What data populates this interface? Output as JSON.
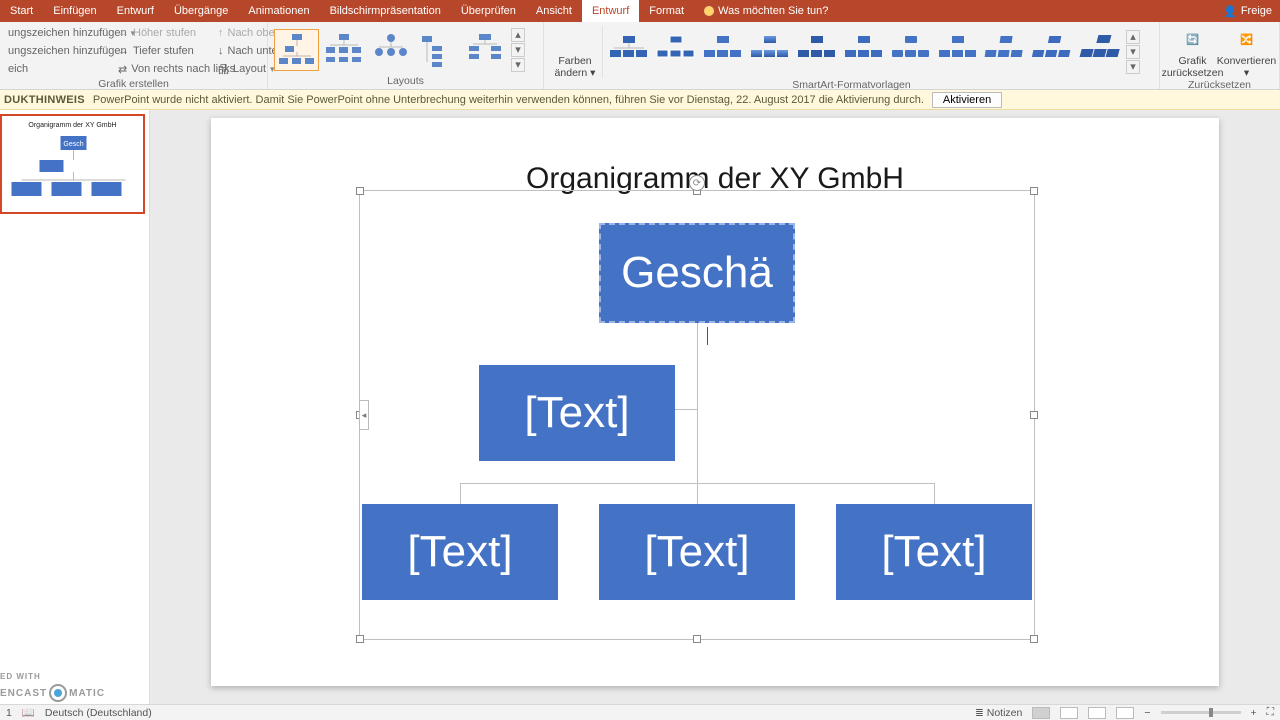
{
  "tabs": [
    "Start",
    "Einfügen",
    "Entwurf",
    "Übergänge",
    "Animationen",
    "Bildschirmpräsentation",
    "Überprüfen",
    "Ansicht",
    "Entwurf",
    "Format"
  ],
  "active_tab_index": 8,
  "tell_me": "Was möchten Sie tun?",
  "user": "Freige",
  "ribbon": {
    "create": {
      "add_bullet": "ungszeichen hinzufügen",
      "add_bullet2": "ungszeichen hinzufügen",
      "eich": "eich",
      "promote": "Höher stufen",
      "demote": "Tiefer stufen",
      "rtl": "Von rechts nach links",
      "up": "Nach oben",
      "down": "Nach unten",
      "layout_btn": "Layout",
      "label": "Grafik erstellen"
    },
    "layouts_label": "Layouts",
    "colors": {
      "label1": "Farben",
      "label2": "ändern"
    },
    "styles_label": "SmartArt-Formatvorlagen",
    "reset": {
      "graphic1": "Grafik",
      "graphic2": "zurücksetzen",
      "convert": "Konvertieren",
      "label": "Zurücksetzen"
    }
  },
  "notice": {
    "tag": "DUKTHINWEIS",
    "text": "PowerPoint wurde nicht aktiviert. Damit Sie PowerPoint ohne Unterbrechung weiterhin verwenden können, führen Sie vor Dienstag, 22. August 2017 die Aktivierung durch.",
    "button": "Aktivieren"
  },
  "slide": {
    "title": "Organigramm der XY GmbH",
    "top_node": "Geschä",
    "placeholder": "[Text]"
  },
  "thumb_title": "Organigramm der XY GmbH",
  "status": {
    "slide_no": "1",
    "lang": "Deutsch (Deutschland)",
    "notes": "Notizen"
  },
  "watermark": {
    "left": "ENCAST",
    "right": "MATIC",
    "top": "ED WITH"
  }
}
